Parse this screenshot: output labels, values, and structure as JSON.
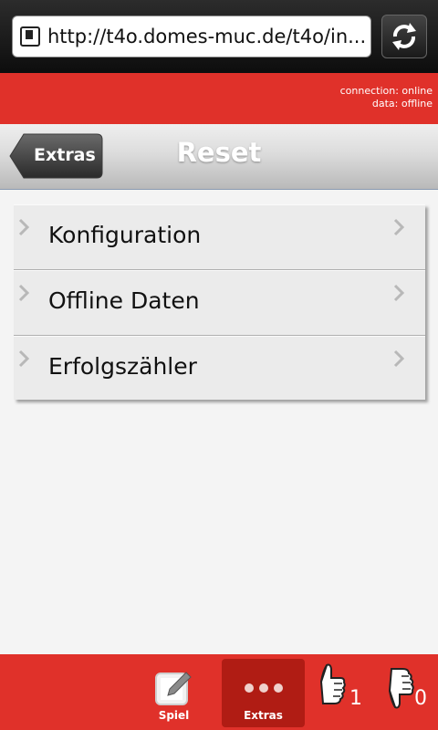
{
  "browser": {
    "url": "http://t4o.domes-muc.de/t4o/in...",
    "site_icon": "page-icon",
    "reload_icon": "reload-icon"
  },
  "status": {
    "connection": "connection: online",
    "data": "data: offline"
  },
  "header": {
    "back_label": "Extras",
    "title": "Reset"
  },
  "menu": {
    "items": [
      {
        "label": "Konfiguration"
      },
      {
        "label": "Offline Daten"
      },
      {
        "label": "Erfolgszähler"
      }
    ]
  },
  "toolbar": {
    "tabs": [
      {
        "label": "Spiel",
        "icon": "edit-icon"
      },
      {
        "label": "Extras",
        "icon": "more-icon",
        "active": true
      }
    ],
    "thumbs_up_count": "1",
    "thumbs_down_count": "0"
  },
  "colors": {
    "accent_red": "#e0312a",
    "active_tab": "#b01c14"
  }
}
